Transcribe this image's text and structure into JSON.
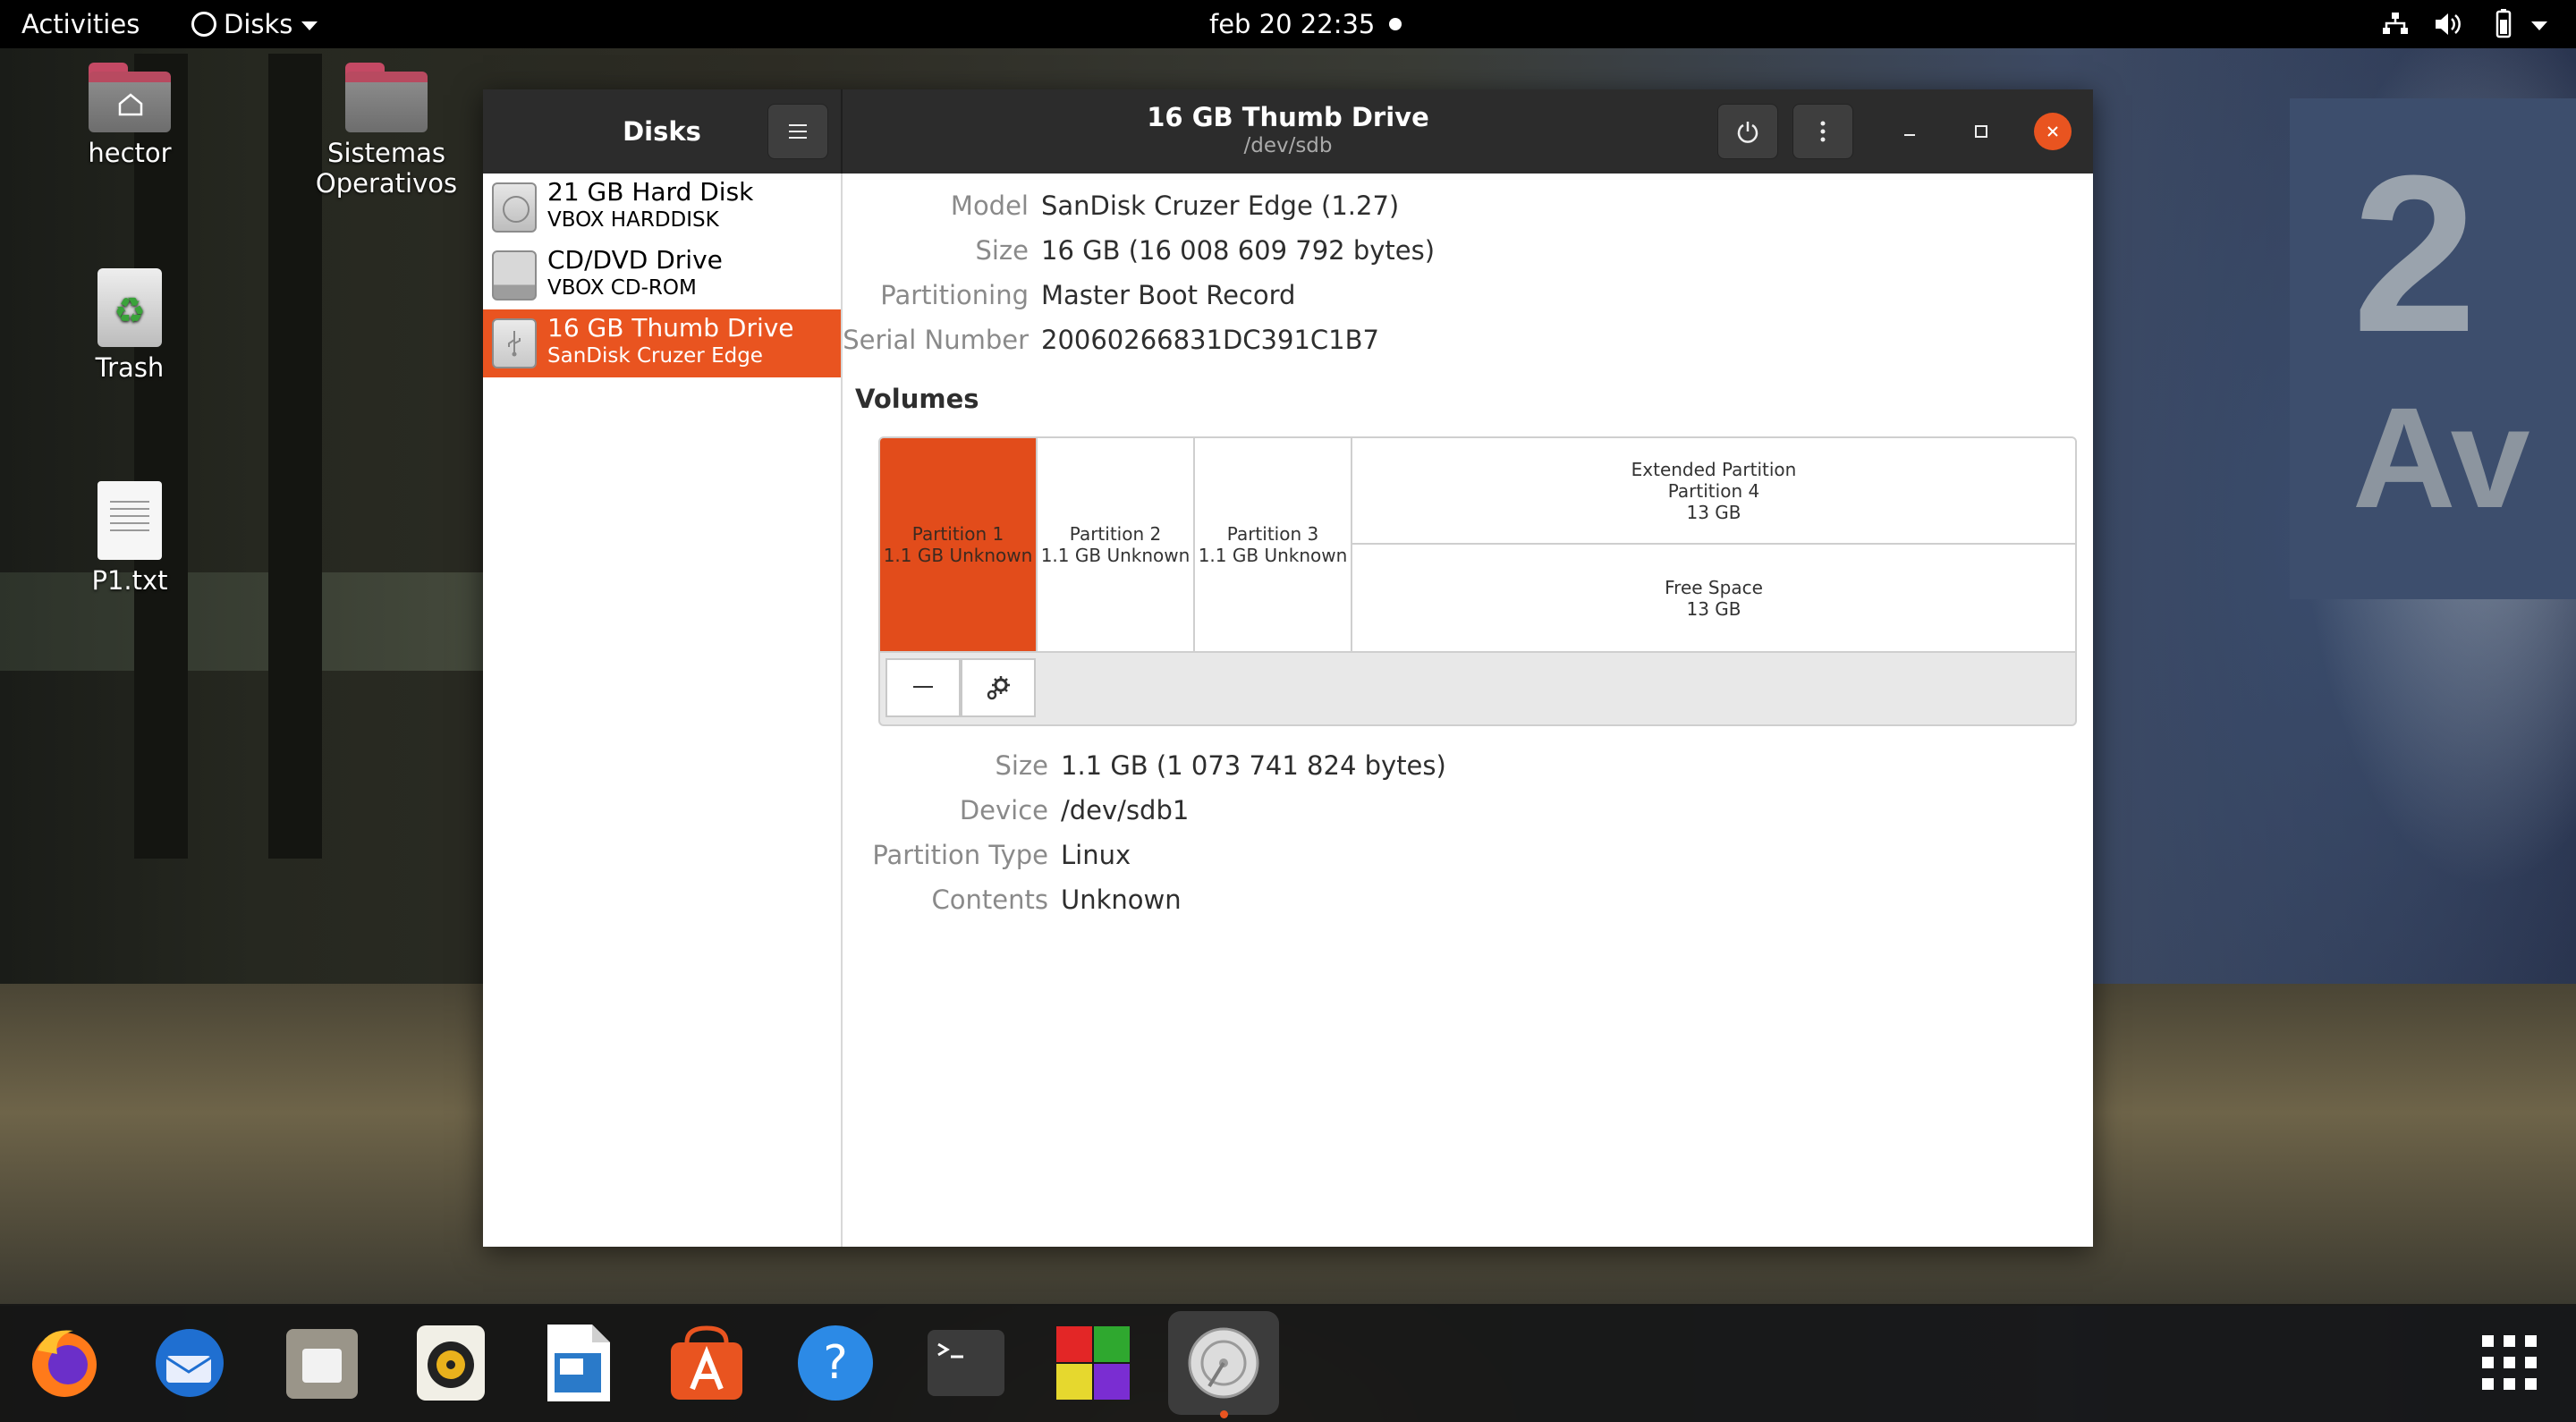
{
  "topbar": {
    "activities": "Activities",
    "app_menu": "Disks",
    "clock": "feb 20  22:35"
  },
  "desktop": {
    "icons": [
      {
        "label": "hector"
      },
      {
        "label_line1": "Sistemas",
        "label_line2": "Operativos"
      },
      {
        "label": "Trash"
      },
      {
        "label": "P1.txt"
      }
    ]
  },
  "window": {
    "sidebar_title": "Disks",
    "title": "16 GB Thumb Drive",
    "subtitle": "/dev/sdb",
    "drives": [
      {
        "title": "21 GB Hard Disk",
        "subtitle": "VBOX HARDDISK",
        "selected": false
      },
      {
        "title": "CD/DVD Drive",
        "subtitle": "VBOX CD-ROM",
        "selected": false
      },
      {
        "title": "16 GB Thumb Drive",
        "subtitle": "SanDisk Cruzer Edge",
        "selected": true
      }
    ],
    "drive_info": {
      "model_label": "Model",
      "model": "SanDisk Cruzer Edge (1.27)",
      "size_label": "Size",
      "size": "16 GB (16 008 609 792 bytes)",
      "partitioning_label": "Partitioning",
      "partitioning": "Master Boot Record",
      "serial_label": "Serial Number",
      "serial": "20060266831DC391C1B7"
    },
    "volumes_heading": "Volumes",
    "partitions": [
      {
        "name": "Partition 1",
        "detail": "1.1 GB Unknown"
      },
      {
        "name": "Partition 2",
        "detail": "1.1 GB Unknown"
      },
      {
        "name": "Partition 3",
        "detail": "1.1 GB Unknown"
      }
    ],
    "extended": {
      "line1": "Extended Partition",
      "line2": "Partition 4",
      "line3": "13 GB"
    },
    "free_space": {
      "line1": "Free Space",
      "line2": "13 GB"
    },
    "volume_info": {
      "size_label": "Size",
      "size": "1.1 GB (1 073 741 824 bytes)",
      "device_label": "Device",
      "device": "/dev/sdb1",
      "ptype_label": "Partition Type",
      "ptype": "Linux",
      "contents_label": "Contents",
      "contents": "Unknown"
    }
  },
  "accent_color": "#e95420"
}
